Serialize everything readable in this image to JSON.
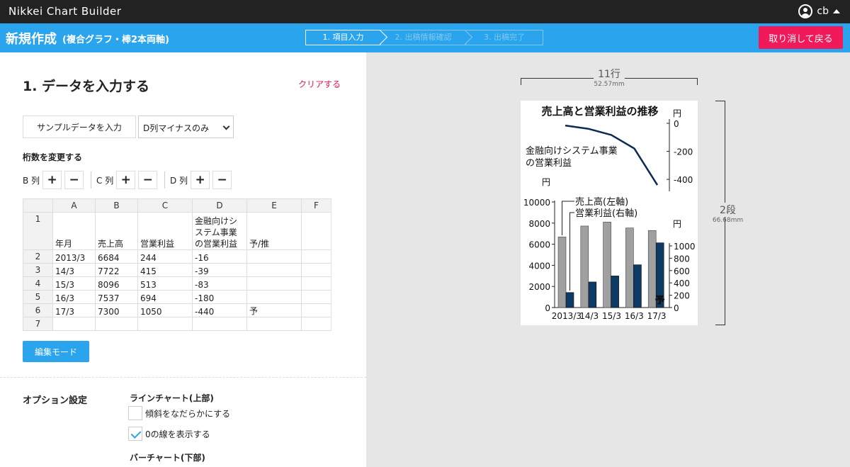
{
  "app": {
    "title": "Nikkei Chart Builder",
    "user": "cb"
  },
  "header": {
    "title": "新規作成",
    "subtitle": "(複合グラフ・棒2本両軸)",
    "steps": [
      "1. 項目入力",
      "2. 出稿情報確認",
      "3. 出稿完了"
    ],
    "cancel_label": "取り消して戻る"
  },
  "panel": {
    "section_title": "1. データを入力する",
    "clear_label": "クリアする",
    "sample_button": "サンプルデータを入力",
    "sample_select": "D列マイナスのみ",
    "digits_label": "桁数を変更する",
    "digit_cols": [
      "B 列",
      "C 列",
      "D 列"
    ],
    "plus": "+",
    "minus": "−",
    "edit_button": "編集モード"
  },
  "sheet": {
    "col_headers": [
      "A",
      "B",
      "C",
      "D",
      "E",
      "F"
    ],
    "row_numbers": [
      "1",
      "2",
      "3",
      "4",
      "5",
      "6",
      "7"
    ],
    "rows": [
      [
        "年月",
        "売上高",
        "営業利益",
        "金融向けシステム事業の営業利益",
        "予/推",
        ""
      ],
      [
        "2013/3",
        "6684",
        "244",
        "-16",
        "",
        ""
      ],
      [
        "14/3",
        "7722",
        "415",
        "-39",
        "",
        ""
      ],
      [
        "15/3",
        "8096",
        "513",
        "-83",
        "",
        ""
      ],
      [
        "16/3",
        "7537",
        "694",
        "-180",
        "",
        ""
      ],
      [
        "17/3",
        "7300",
        "1050",
        "-440",
        "予",
        ""
      ],
      [
        "",
        "",
        "",
        "",
        "",
        ""
      ]
    ]
  },
  "options": {
    "title": "オプション設定",
    "line_section": "ラインチャート(上部)",
    "smooth_label": "傾斜をなだらかにする",
    "smooth_checked": false,
    "zero_label": "0の線を表示する",
    "zero_checked": true,
    "bar_section": "バーチャート(下部)"
  },
  "preview": {
    "width_label": "11行",
    "width_mm": "52.57mm",
    "height_label": "2段",
    "height_mm": "66.68mm"
  },
  "chart_data": {
    "type": "bar+line",
    "title": "売上高と営業利益の推移",
    "categories": [
      "2013/3",
      "14/3",
      "15/3",
      "16/3",
      "17/3"
    ],
    "line": {
      "label": "金融向けシステム事業の営業利益",
      "label_lines": [
        "金融向けシステム事業",
        "の営業利益"
      ],
      "unit": "円",
      "values": [
        -16,
        -39,
        -83,
        -180,
        -440
      ],
      "ylim": [
        -450,
        0
      ],
      "ticks": [
        "0",
        "-200",
        "-400"
      ]
    },
    "bars": {
      "unit_left": "円",
      "unit_right": "円",
      "series": [
        {
          "name": "売上高(左軸)",
          "values": [
            6684,
            7722,
            8096,
            7537,
            7300
          ],
          "color": "#a0a0a0",
          "axis": "left"
        },
        {
          "name": "営業利益(右軸)",
          "values": [
            244,
            415,
            513,
            694,
            1050
          ],
          "color": "#0d3a63",
          "axis": "right"
        }
      ],
      "left_ylim": [
        0,
        10000
      ],
      "left_ticks": [
        "10000",
        "8000",
        "6000",
        "4000",
        "2000",
        "0"
      ],
      "right_ylim": [
        0,
        1000
      ],
      "right_ticks": [
        "1000",
        "800",
        "600",
        "400",
        "200",
        "0"
      ],
      "forecast_mark": "予"
    },
    "colors": {
      "line": "#0d2a52",
      "left_bar": "#a0a0a0",
      "right_bar": "#0d3a63"
    }
  }
}
